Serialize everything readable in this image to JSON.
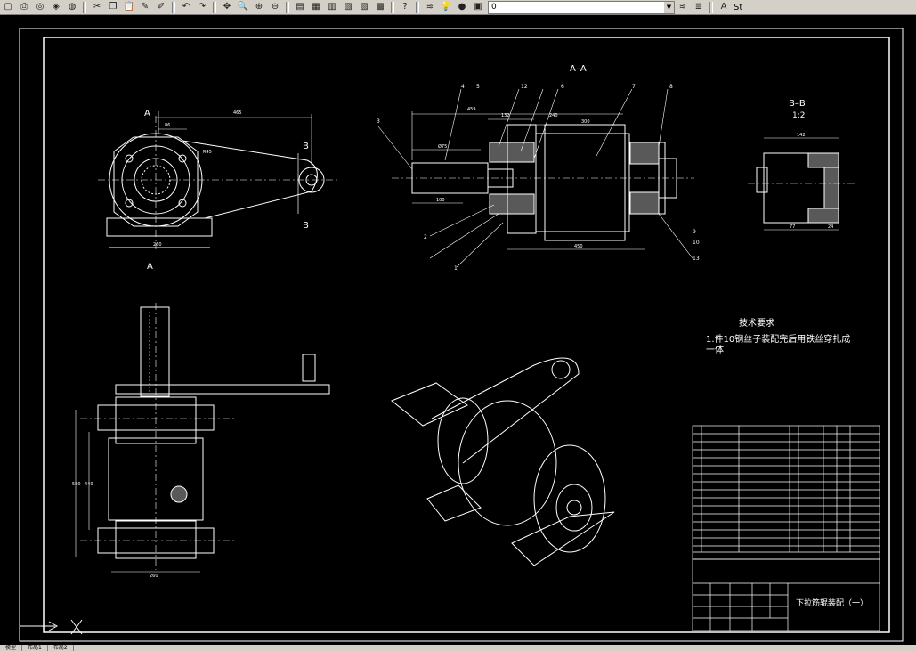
{
  "toolbar": {
    "layer_value": "0",
    "style_label": "St"
  },
  "drawing": {
    "section_a": "A",
    "section_b": "B",
    "view_aa_title": "A–A",
    "view_bb_title": "B–B",
    "view_bb_scale": "1:2",
    "tech_req_title": "技术要求",
    "tech_req_line1": "1.件10钢丝子装配完后用铁丝穿扎成",
    "tech_req_line2": "一体",
    "title_block_name": "下拉筋辊装配（一）",
    "dims_front": {
      "d1": "465",
      "d2": "86",
      "d3": "260",
      "d4": "R45"
    },
    "dims_aa": {
      "d1": "459",
      "d2": "132",
      "d3": "240",
      "d4": "300",
      "d5": "450",
      "d6": "100",
      "d7": "Ø75"
    },
    "dims_bb": {
      "d1": "142",
      "d2": "77",
      "d3": "24"
    },
    "dims_side": {
      "d1": "580",
      "d2": "440",
      "d3": "260"
    },
    "balloons_aa": [
      "4",
      "5",
      "12",
      "6",
      "7",
      "8",
      "9",
      "1",
      "2",
      "3",
      "10",
      "13"
    ]
  },
  "status": {
    "tab_model": "模型",
    "tab_layout1": "布局1",
    "tab_layout2": "布局2"
  },
  "colors": {
    "background": "#000000",
    "lines": "#ffffff",
    "toolbar": "#d4d0c8"
  }
}
